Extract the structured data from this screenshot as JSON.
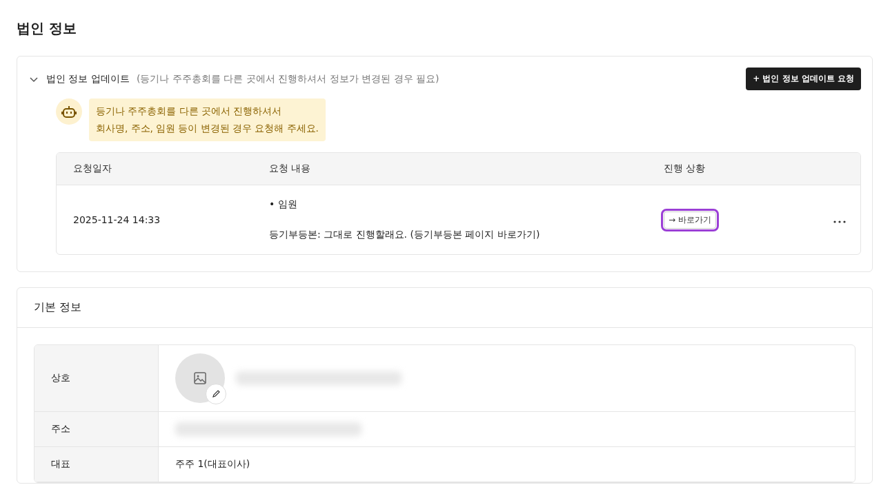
{
  "page_title": "법인 정보",
  "update_section": {
    "expanded": true,
    "title": "법인 정보 업데이트",
    "subtitle": "(등기나 주주총회를 다른 곳에서 진행하셔서 정보가 변경된 경우 필요)",
    "request_button": "+ 법인 정보 업데이트 요청",
    "notice_lines": [
      "등기나 주주총회를 다른 곳에서 진행하셔서",
      "회사명, 주소, 임원 등이 변경된 경우 요청해 주세요."
    ],
    "table": {
      "columns": [
        "요청일자",
        "요청 내용",
        "진행 상황"
      ],
      "rows": [
        {
          "date": "2025-11-24 14:33",
          "item": "• 임원",
          "detail": "등기부등본: 그대로 진행할래요. (등기부등본 페이지 바로가기)",
          "status_button": "→ 바로가기",
          "highlighted": true
        }
      ]
    }
  },
  "basic_info": {
    "title": "기본 정보",
    "rows": [
      {
        "label": "상호",
        "kind": "logo_name",
        "blurred": true
      },
      {
        "label": "주소",
        "kind": "text",
        "blurred": true
      },
      {
        "label": "대표",
        "kind": "text",
        "blurred": false,
        "value": "주주 1(대표이사)"
      }
    ]
  }
}
